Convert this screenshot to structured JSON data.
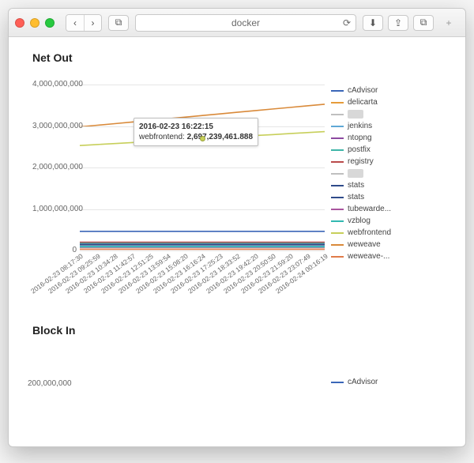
{
  "browser": {
    "url_text": "docker",
    "back_icon": "‹",
    "forward_icon": "›",
    "sidebar_icon": "⧉",
    "reload_icon": "⟳",
    "download_icon": "⬇",
    "share_icon": "⇪",
    "tabs_icon": "⧉",
    "plus_icon": "+"
  },
  "chart1": {
    "title": "Net Out",
    "tooltip_time": "2016-02-23 16:22:15",
    "tooltip_series": "webfrontend:",
    "tooltip_value": "2,697,239,461.888"
  },
  "chart2": {
    "title": "Block In"
  },
  "chart_data": [
    {
      "type": "line",
      "title": "Net Out",
      "xlabel": "",
      "ylabel": "",
      "ylim": [
        0,
        4000000000
      ],
      "yticks": [
        0,
        1000000000,
        2000000000,
        3000000000,
        4000000000
      ],
      "ytick_labels": [
        "0",
        "1,000,000,000",
        "2,000,000,000",
        "3,000,000,000",
        "4,000,000,000"
      ],
      "categories": [
        "2016-02-23 08:17:30",
        "2016-02-23 09:25:59",
        "2016-02-23 10:34:28",
        "2016-02-23 11:42:57",
        "2016-02-23 12:51:25",
        "2016-02-23 13:59:54",
        "2016-02-23 15:08:20",
        "2016-02-23 16:16:24",
        "2016-02-23 17:25:23",
        "2016-02-23 18:33:52",
        "2016-02-23 19:42:20",
        "2016-02-23 20:50:50",
        "2016-02-23 21:59:20",
        "2016-02-23 23:07:49",
        "2016-02-24 00:16:19"
      ],
      "series": [
        {
          "name": "cAdvisor",
          "color": "#3a66b8",
          "values": [
            460000000,
            460000000,
            460000000,
            460000000,
            460000000,
            460000000,
            460000000,
            460000000,
            460000000,
            460000000,
            460000000,
            460000000,
            460000000,
            460000000,
            460000000
          ]
        },
        {
          "name": "delicarta",
          "color": "#e69b3a",
          "values": [
            120000000,
            120000000,
            120000000,
            120000000,
            120000000,
            120000000,
            120000000,
            120000000,
            120000000,
            120000000,
            120000000,
            120000000,
            120000000,
            120000000,
            120000000
          ]
        },
        {
          "name": "",
          "color": "#bfbfbf",
          "values": [
            110000000,
            110000000,
            110000000,
            110000000,
            110000000,
            110000000,
            110000000,
            110000000,
            110000000,
            110000000,
            110000000,
            110000000,
            110000000,
            110000000,
            110000000
          ]
        },
        {
          "name": "jenkins",
          "color": "#5fa8d6",
          "values": [
            100000000,
            100000000,
            100000000,
            100000000,
            100000000,
            100000000,
            100000000,
            100000000,
            100000000,
            100000000,
            100000000,
            100000000,
            100000000,
            100000000,
            100000000
          ]
        },
        {
          "name": "ntopng",
          "color": "#8c4aa0",
          "values": [
            150000000,
            150000000,
            150000000,
            150000000,
            150000000,
            150000000,
            150000000,
            150000000,
            150000000,
            150000000,
            150000000,
            150000000,
            150000000,
            150000000,
            150000000
          ]
        },
        {
          "name": "postfix",
          "color": "#3fb5a8",
          "values": [
            180000000,
            180000000,
            180000000,
            180000000,
            180000000,
            180000000,
            180000000,
            180000000,
            180000000,
            180000000,
            180000000,
            180000000,
            180000000,
            180000000,
            180000000
          ]
        },
        {
          "name": "registry",
          "color": "#b94b4b",
          "values": [
            200000000,
            200000000,
            200000000,
            200000000,
            200000000,
            200000000,
            200000000,
            200000000,
            200000000,
            200000000,
            200000000,
            200000000,
            200000000,
            200000000,
            200000000
          ]
        },
        {
          "name": "",
          "color": "#bfbfbf",
          "values": [
            70000000,
            70000000,
            70000000,
            70000000,
            70000000,
            70000000,
            70000000,
            70000000,
            70000000,
            70000000,
            70000000,
            70000000,
            70000000,
            70000000,
            70000000
          ]
        },
        {
          "name": "stats",
          "color": "#2f4b8a",
          "values": [
            140000000,
            140000000,
            140000000,
            140000000,
            140000000,
            140000000,
            140000000,
            140000000,
            140000000,
            140000000,
            140000000,
            140000000,
            140000000,
            140000000,
            140000000
          ]
        },
        {
          "name": "stats",
          "color": "#2f4b8a",
          "values": [
            145000000,
            145000000,
            145000000,
            145000000,
            145000000,
            145000000,
            145000000,
            145000000,
            145000000,
            145000000,
            145000000,
            145000000,
            145000000,
            145000000,
            145000000
          ]
        },
        {
          "name": "tubewarde...",
          "color": "#a9559e",
          "values": [
            80000000,
            80000000,
            80000000,
            80000000,
            80000000,
            80000000,
            80000000,
            80000000,
            80000000,
            80000000,
            80000000,
            80000000,
            80000000,
            80000000,
            80000000
          ]
        },
        {
          "name": "vzblog",
          "color": "#32b8b1",
          "values": [
            90000000,
            90000000,
            90000000,
            90000000,
            90000000,
            90000000,
            90000000,
            90000000,
            90000000,
            90000000,
            90000000,
            90000000,
            90000000,
            90000000,
            90000000
          ]
        },
        {
          "name": "webfrontend",
          "color": "#c7cf5a",
          "values": [
            2530000000,
            2554000000,
            2578000000,
            2602000000,
            2626000000,
            2650000000,
            2674000000,
            2697239462,
            2721000000,
            2745000000,
            2769000000,
            2793000000,
            2817000000,
            2841000000,
            2865000000
          ]
        },
        {
          "name": "weweave",
          "color": "#d98a3a",
          "values": [
            2980000000,
            3019000000,
            3058000000,
            3097000000,
            3136000000,
            3175000000,
            3214000000,
            3253000000,
            3292000000,
            3331000000,
            3370000000,
            3409000000,
            3448000000,
            3487000000,
            3526000000
          ]
        },
        {
          "name": "weweave-...",
          "color": "#e07b4a",
          "values": [
            30000000,
            30000000,
            30000000,
            30000000,
            30000000,
            30000000,
            30000000,
            30000000,
            30000000,
            30000000,
            30000000,
            30000000,
            30000000,
            30000000,
            30000000
          ]
        }
      ],
      "tooltip_point": {
        "series": "webfrontend",
        "x_index": 7,
        "x": "2016-02-23 16:22:15",
        "y": 2697239461.888
      }
    },
    {
      "type": "line",
      "title": "Block In",
      "ylim": [
        0,
        200000000
      ],
      "yticks": [
        200000000
      ],
      "ytick_labels": [
        "200,000,000"
      ],
      "categories": [],
      "series": [
        {
          "name": "cAdvisor",
          "color": "#3a66b8",
          "values": []
        }
      ]
    }
  ]
}
